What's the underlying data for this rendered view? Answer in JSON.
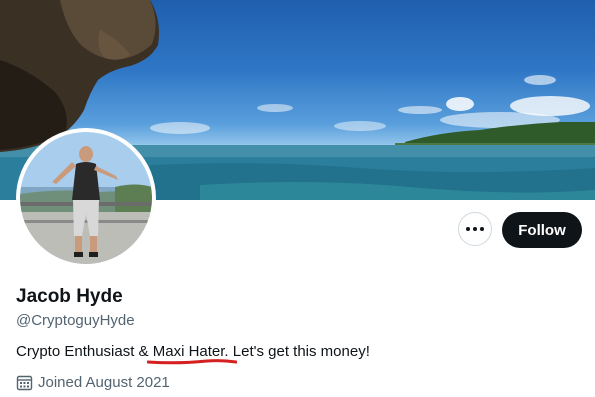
{
  "profile": {
    "display_name": "Jacob Hyde",
    "handle": "@CryptoguyHyde",
    "bio": "Crypto Enthusiast & Maxi Hater. Let's get this money!",
    "joined": "Joined August 2021"
  },
  "actions": {
    "follow_label": "Follow",
    "more_icon": "more-horizontal-icon"
  },
  "icons": {
    "joined": "calendar-icon"
  },
  "colors": {
    "follow_button": "#0f1419",
    "secondary_text": "#536471",
    "annotation_underline": "#d42020"
  }
}
